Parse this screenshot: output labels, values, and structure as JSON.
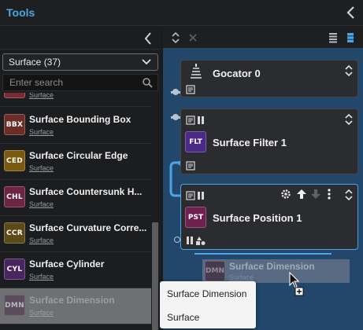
{
  "window": {
    "title": "Tools"
  },
  "tool_list": {
    "category_select": "Surface (37)",
    "search_placeholder": "Enter search",
    "items": [
      {
        "code": "",
        "name": "",
        "category": "Surface",
        "color": "#7a2a36"
      },
      {
        "code": "BBX",
        "name": "Surface Bounding Box",
        "category": "Surface",
        "color": "#6a2e26"
      },
      {
        "code": "CED",
        "name": "Surface Circular Edge",
        "category": "Surface",
        "color": "#7a5a10"
      },
      {
        "code": "CHL",
        "name": "Surface Countersunk H...",
        "category": "Surface",
        "color": "#6e2540"
      },
      {
        "code": "CCR",
        "name": "Surface Curvature Corre...",
        "category": "Surface",
        "color": "#5c4a18"
      },
      {
        "code": "CYL",
        "name": "Surface Cylinder",
        "category": "Surface",
        "color": "#4a2660"
      },
      {
        "code": "DMN",
        "name": "Surface Dimension",
        "category": "Surface",
        "color": "#4a2a44"
      }
    ]
  },
  "pipeline": {
    "nodes": [
      {
        "title": "Gocator 0"
      },
      {
        "code": "FLT",
        "title": "Surface Filter 1",
        "color": "#4a2a86"
      },
      {
        "code": "PST",
        "title": "Surface Position 1",
        "color": "#6e2050"
      }
    ],
    "drag_preview": {
      "code": "DMN",
      "name": "Surface Dimension",
      "category": "Surface"
    }
  },
  "tooltip": {
    "name": "Surface Dimension",
    "category": "Surface"
  }
}
